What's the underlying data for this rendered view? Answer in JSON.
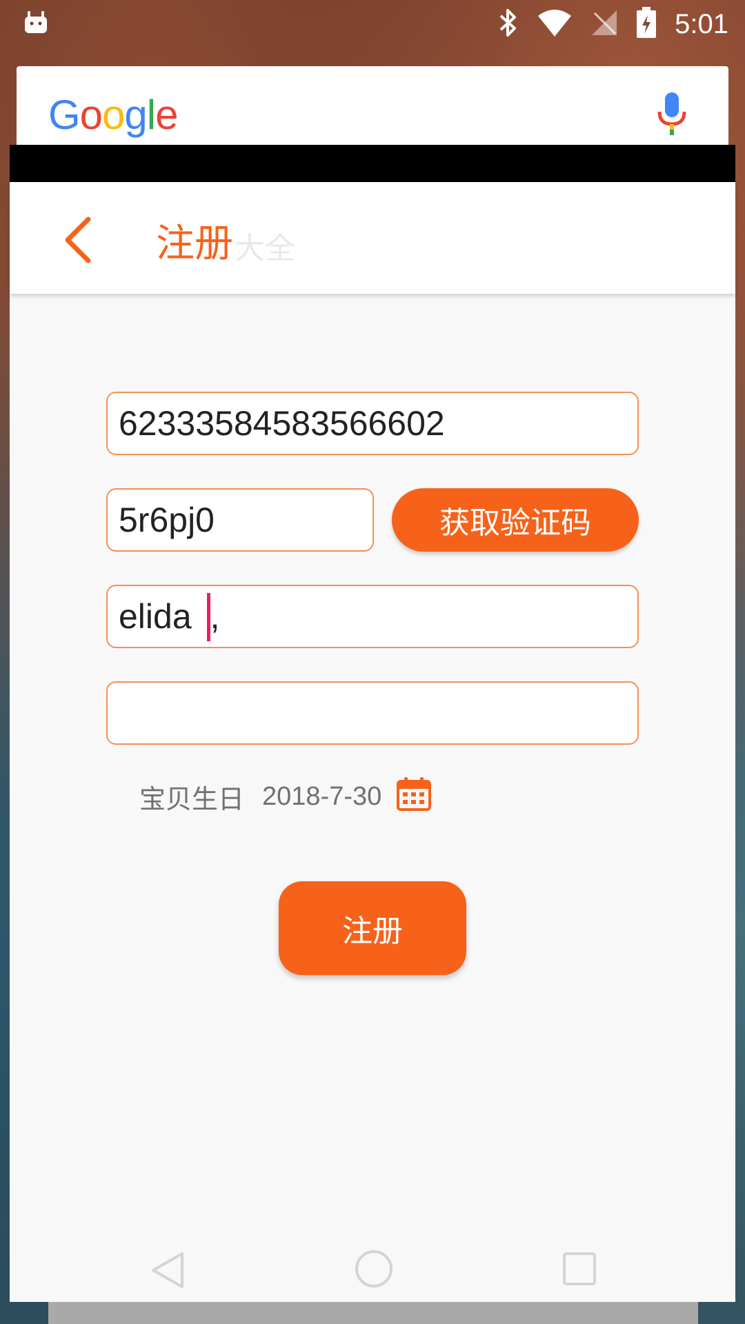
{
  "status_bar": {
    "time": "5:01",
    "icons": [
      "android-icon",
      "bluetooth-icon",
      "wifi-icon",
      "no-signal-icon",
      "battery-charging-icon"
    ]
  },
  "google_widget": {
    "logo_letters": [
      "G",
      "o",
      "o",
      "g",
      "l",
      "e"
    ],
    "mic_icon": "mic-icon"
  },
  "app": {
    "toolbar": {
      "back_icon": "chevron-left-icon",
      "title": "注册",
      "ghost_text": "大全"
    },
    "form": {
      "account_value": "62333584583566602",
      "code_value": "5r6pj0",
      "get_code_label": "获取验证码",
      "name_value": "elida",
      "name_trailing": ",",
      "password_value": "",
      "birthday_label": "宝贝生日",
      "birthday_value": "2018-7-30",
      "calendar_icon": "calendar-icon",
      "register_label": "注册"
    },
    "colors": {
      "accent": "#f7621a",
      "field_border": "#f39056",
      "caret": "#e91e63",
      "background": "#f8f8f8"
    }
  },
  "nav_bar": {
    "icons": [
      "nav-back-icon",
      "nav-home-icon",
      "nav-recents-icon"
    ]
  }
}
